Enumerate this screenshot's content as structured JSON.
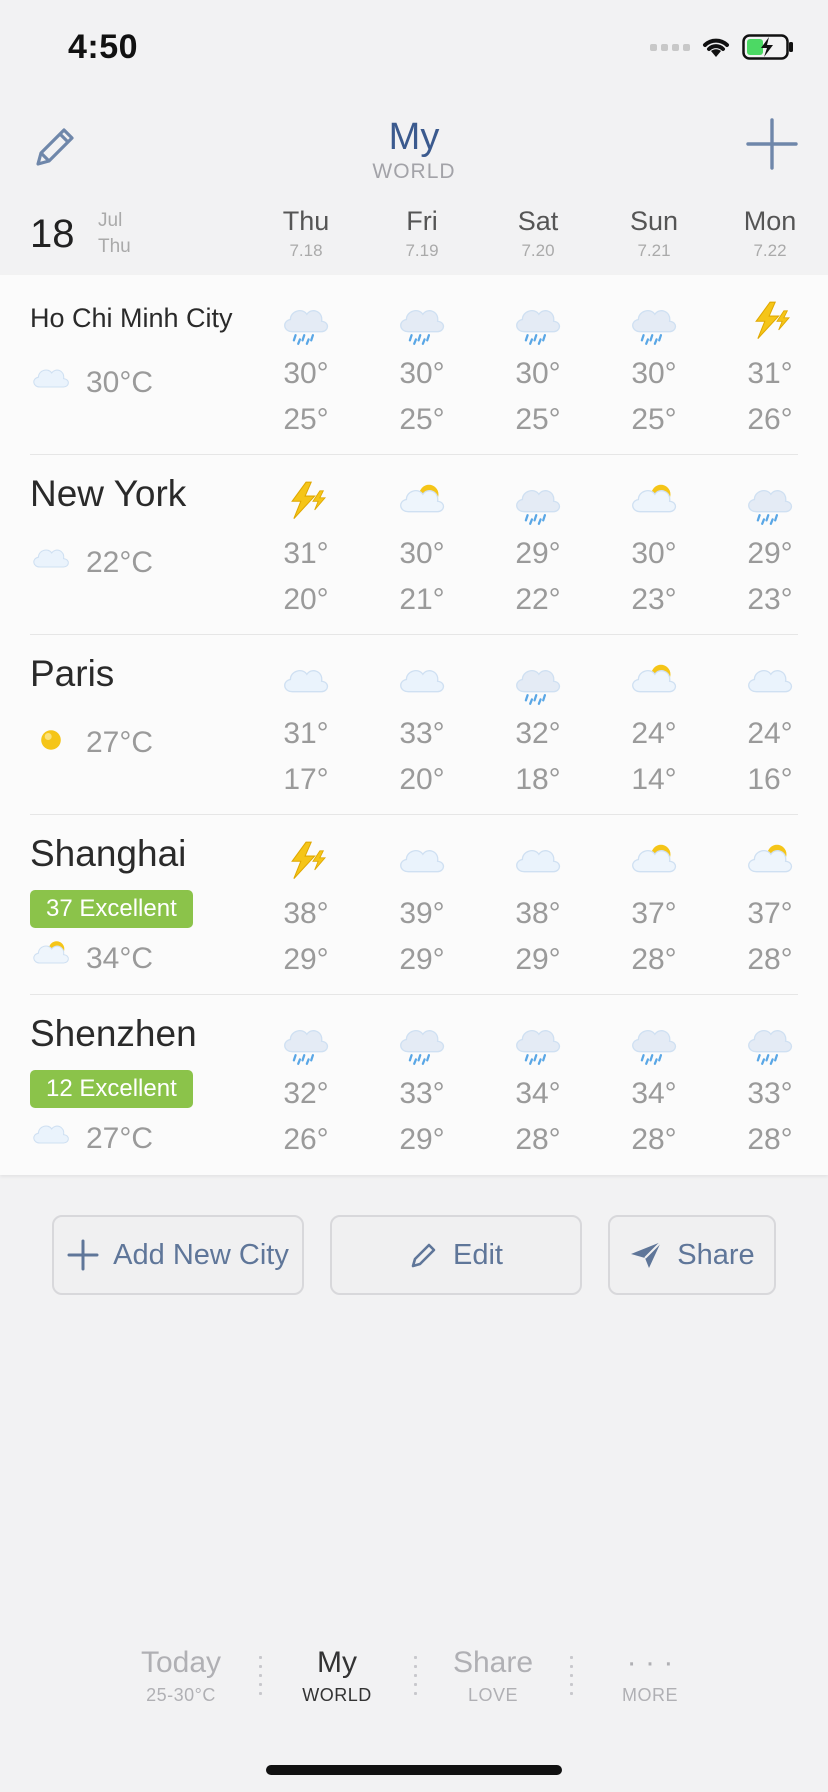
{
  "status": {
    "time": "4:50"
  },
  "header": {
    "title": "My",
    "subtitle": "WORLD"
  },
  "date": {
    "day": "18",
    "month": "Jul",
    "weekday": "Thu"
  },
  "days": [
    {
      "name": "Thu",
      "date": "7.18"
    },
    {
      "name": "Fri",
      "date": "7.19"
    },
    {
      "name": "Sat",
      "date": "7.20"
    },
    {
      "name": "Sun",
      "date": "7.21"
    },
    {
      "name": "Mon",
      "date": "7.22"
    }
  ],
  "cities": [
    {
      "name": "Ho Chi Minh City",
      "aqi": "",
      "current_icon": "cloud-icon",
      "current_temp": "30°C",
      "forecast": [
        {
          "icon": "rain-icon",
          "hi": "30°",
          "lo": "25°"
        },
        {
          "icon": "rain-icon",
          "hi": "30°",
          "lo": "25°"
        },
        {
          "icon": "rain-icon",
          "hi": "30°",
          "lo": "25°"
        },
        {
          "icon": "rain-icon",
          "hi": "30°",
          "lo": "25°"
        },
        {
          "icon": "thunder-icon",
          "hi": "31°",
          "lo": "26°"
        }
      ]
    },
    {
      "name": "New York",
      "aqi": "",
      "current_icon": "cloud-icon",
      "current_temp": "22°C",
      "forecast": [
        {
          "icon": "thunder-icon",
          "hi": "31°",
          "lo": "20°"
        },
        {
          "icon": "partly-cloudy-icon",
          "hi": "30°",
          "lo": "21°"
        },
        {
          "icon": "rain-icon",
          "hi": "29°",
          "lo": "22°"
        },
        {
          "icon": "partly-cloudy-icon",
          "hi": "30°",
          "lo": "23°"
        },
        {
          "icon": "rain-icon",
          "hi": "29°",
          "lo": "23°"
        }
      ]
    },
    {
      "name": "Paris",
      "aqi": "",
      "current_icon": "sun-icon",
      "current_temp": "27°C",
      "forecast": [
        {
          "icon": "cloud-icon",
          "hi": "31°",
          "lo": "17°"
        },
        {
          "icon": "cloud-icon",
          "hi": "33°",
          "lo": "20°"
        },
        {
          "icon": "rain-icon",
          "hi": "32°",
          "lo": "18°"
        },
        {
          "icon": "partly-cloudy-icon",
          "hi": "24°",
          "lo": "14°"
        },
        {
          "icon": "cloud-icon",
          "hi": "24°",
          "lo": "16°"
        }
      ]
    },
    {
      "name": "Shanghai",
      "aqi": "37 Excellent",
      "current_icon": "partly-cloudy-icon",
      "current_temp": "34°C",
      "forecast": [
        {
          "icon": "thunder-icon",
          "hi": "38°",
          "lo": "29°"
        },
        {
          "icon": "cloud-icon",
          "hi": "39°",
          "lo": "29°"
        },
        {
          "icon": "cloud-icon",
          "hi": "38°",
          "lo": "29°"
        },
        {
          "icon": "partly-cloudy-icon",
          "hi": "37°",
          "lo": "28°"
        },
        {
          "icon": "partly-cloudy-icon",
          "hi": "37°",
          "lo": "28°"
        }
      ]
    },
    {
      "name": "Shenzhen",
      "aqi": "12 Excellent",
      "current_icon": "cloud-icon",
      "current_temp": "27°C",
      "forecast": [
        {
          "icon": "rain-icon",
          "hi": "32°",
          "lo": "26°"
        },
        {
          "icon": "rain-icon",
          "hi": "33°",
          "lo": "29°"
        },
        {
          "icon": "rain-icon",
          "hi": "34°",
          "lo": "28°"
        },
        {
          "icon": "rain-icon",
          "hi": "34°",
          "lo": "28°"
        },
        {
          "icon": "rain-icon",
          "hi": "33°",
          "lo": "28°"
        }
      ]
    }
  ],
  "actions": {
    "add": "Add New City",
    "edit": "Edit",
    "share": "Share"
  },
  "tabs": [
    {
      "label": "Today",
      "sub": "25-30°C"
    },
    {
      "label": "My",
      "sub": "WORLD"
    },
    {
      "label": "Share",
      "sub": "LOVE"
    },
    {
      "label": "· · ·",
      "sub": "MORE"
    }
  ],
  "colors": {
    "accent": "#3b5a8e",
    "aqi_good": "#8bc34a",
    "sun": "#f5c518"
  }
}
